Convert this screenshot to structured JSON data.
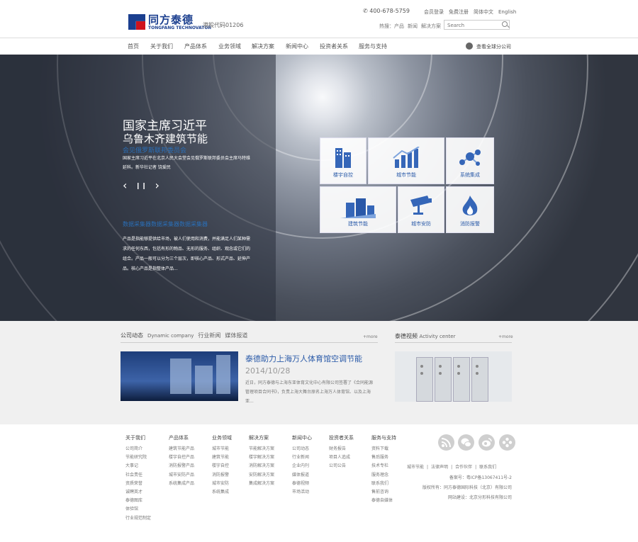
{
  "header": {
    "logo_cn": "同方泰德",
    "logo_en": "TONGFANG TECHNOVATOR",
    "stock_code": "港股代码01206",
    "phone": "400-678-5759",
    "top_links": [
      "会员登录",
      "免费注册",
      "简体中文",
      "English"
    ],
    "hot_label": "热搜：",
    "hot_links": [
      "产品",
      "新闻",
      "解决方案"
    ],
    "search_placeholder": "Search"
  },
  "nav": {
    "items": [
      "首页",
      "关于我们",
      "产品体系",
      "业务领域",
      "解决方案",
      "新闻中心",
      "投资者关系",
      "服务与支持"
    ],
    "global": "查看全球分公司"
  },
  "hero": {
    "title1": "国家主席习近平",
    "title2": "乌鲁木齐建筑节能",
    "subtitle": "会见俄罗斯联邦委员会",
    "desc": "国家主席习近平在北京人民大会堂会见俄罗斯联邦委员会主席马特维延科。新华社记者 饶爱民",
    "controls": "‹ ıı ›",
    "subtitle2": "数据采集器数据采集器数据采集器",
    "desc2": "产品是指能够提供给市场，被人们使用和消费，并能满足人们某种需求的任何东西，包括有形的物品、无形的服务、组织、观念或它们的组合。产品一般可以分为三个层次，即核心产品、形式产品、延伸产品。核心产品是指整体产品...",
    "tiles": [
      "楼宇自控",
      "城市节能",
      "系统集成",
      "建筑节能",
      "城市安防",
      "消防报警"
    ]
  },
  "news": {
    "tabs": [
      "公司动态",
      "Dynamic company",
      "行业新闻",
      "媒体报道"
    ],
    "more": "+more",
    "title": "泰德助力上海万人体育馆空调节能",
    "date": "2014/10/28",
    "desc": "近日，同方泰德与上海东亚体育文化中心有限公司签署了《合同能源管理项目合同书》，负责上海大舞台原名上海万人体育馆、以及上海亚..."
  },
  "video": {
    "title": "泰德视频",
    "title_en": "Activity center",
    "more": "+more"
  },
  "footer": {
    "columns": [
      {
        "head": "关于我们",
        "links": [
          "公司简介",
          "节能研究院",
          "大事记",
          "社会责任",
          "资质荣誉",
          "诚聘英才",
          "泰德图库",
          "体验馆",
          "行业规范制定"
        ]
      },
      {
        "head": "产品体系",
        "links": [
          "建筑节能产品",
          "楼宇自控产品",
          "消防报警产品",
          "城市安防产品",
          "系统集成产品"
        ]
      },
      {
        "head": "业务领域",
        "links": [
          "城市节能",
          "建筑节能",
          "楼宇自控",
          "消防报警",
          "城市安防",
          "系统集成"
        ]
      },
      {
        "head": "解决方案",
        "links": [
          "节能解决方案",
          "楼宇解决方案",
          "消防解决方案",
          "安防解决方案",
          "集成解决方案"
        ]
      },
      {
        "head": "新闻中心",
        "links": [
          "公司动态",
          "行业新闻",
          "企业内刊",
          "媒体报道",
          "泰德视频",
          "市场活动"
        ]
      },
      {
        "head": "投资者关系",
        "links": [
          "财务报告",
          "项目人追成",
          "公司公告"
        ]
      },
      {
        "head": "服务与支持",
        "links": [
          "资料下载",
          "售后服务",
          "技术专栏",
          "服务理念",
          "联系我们",
          "售前咨询",
          "泰德自媒体"
        ]
      }
    ],
    "bottom_links": [
      "城市节能",
      "法律声明",
      "合作伙伴",
      "联系我们"
    ],
    "icp": "备案号：粤ICP备13067411号-2",
    "copyright": "版权所有：同方泰德国际科技（北京）有限公司",
    "support": "网站建设：北京分形科技有限公司"
  }
}
